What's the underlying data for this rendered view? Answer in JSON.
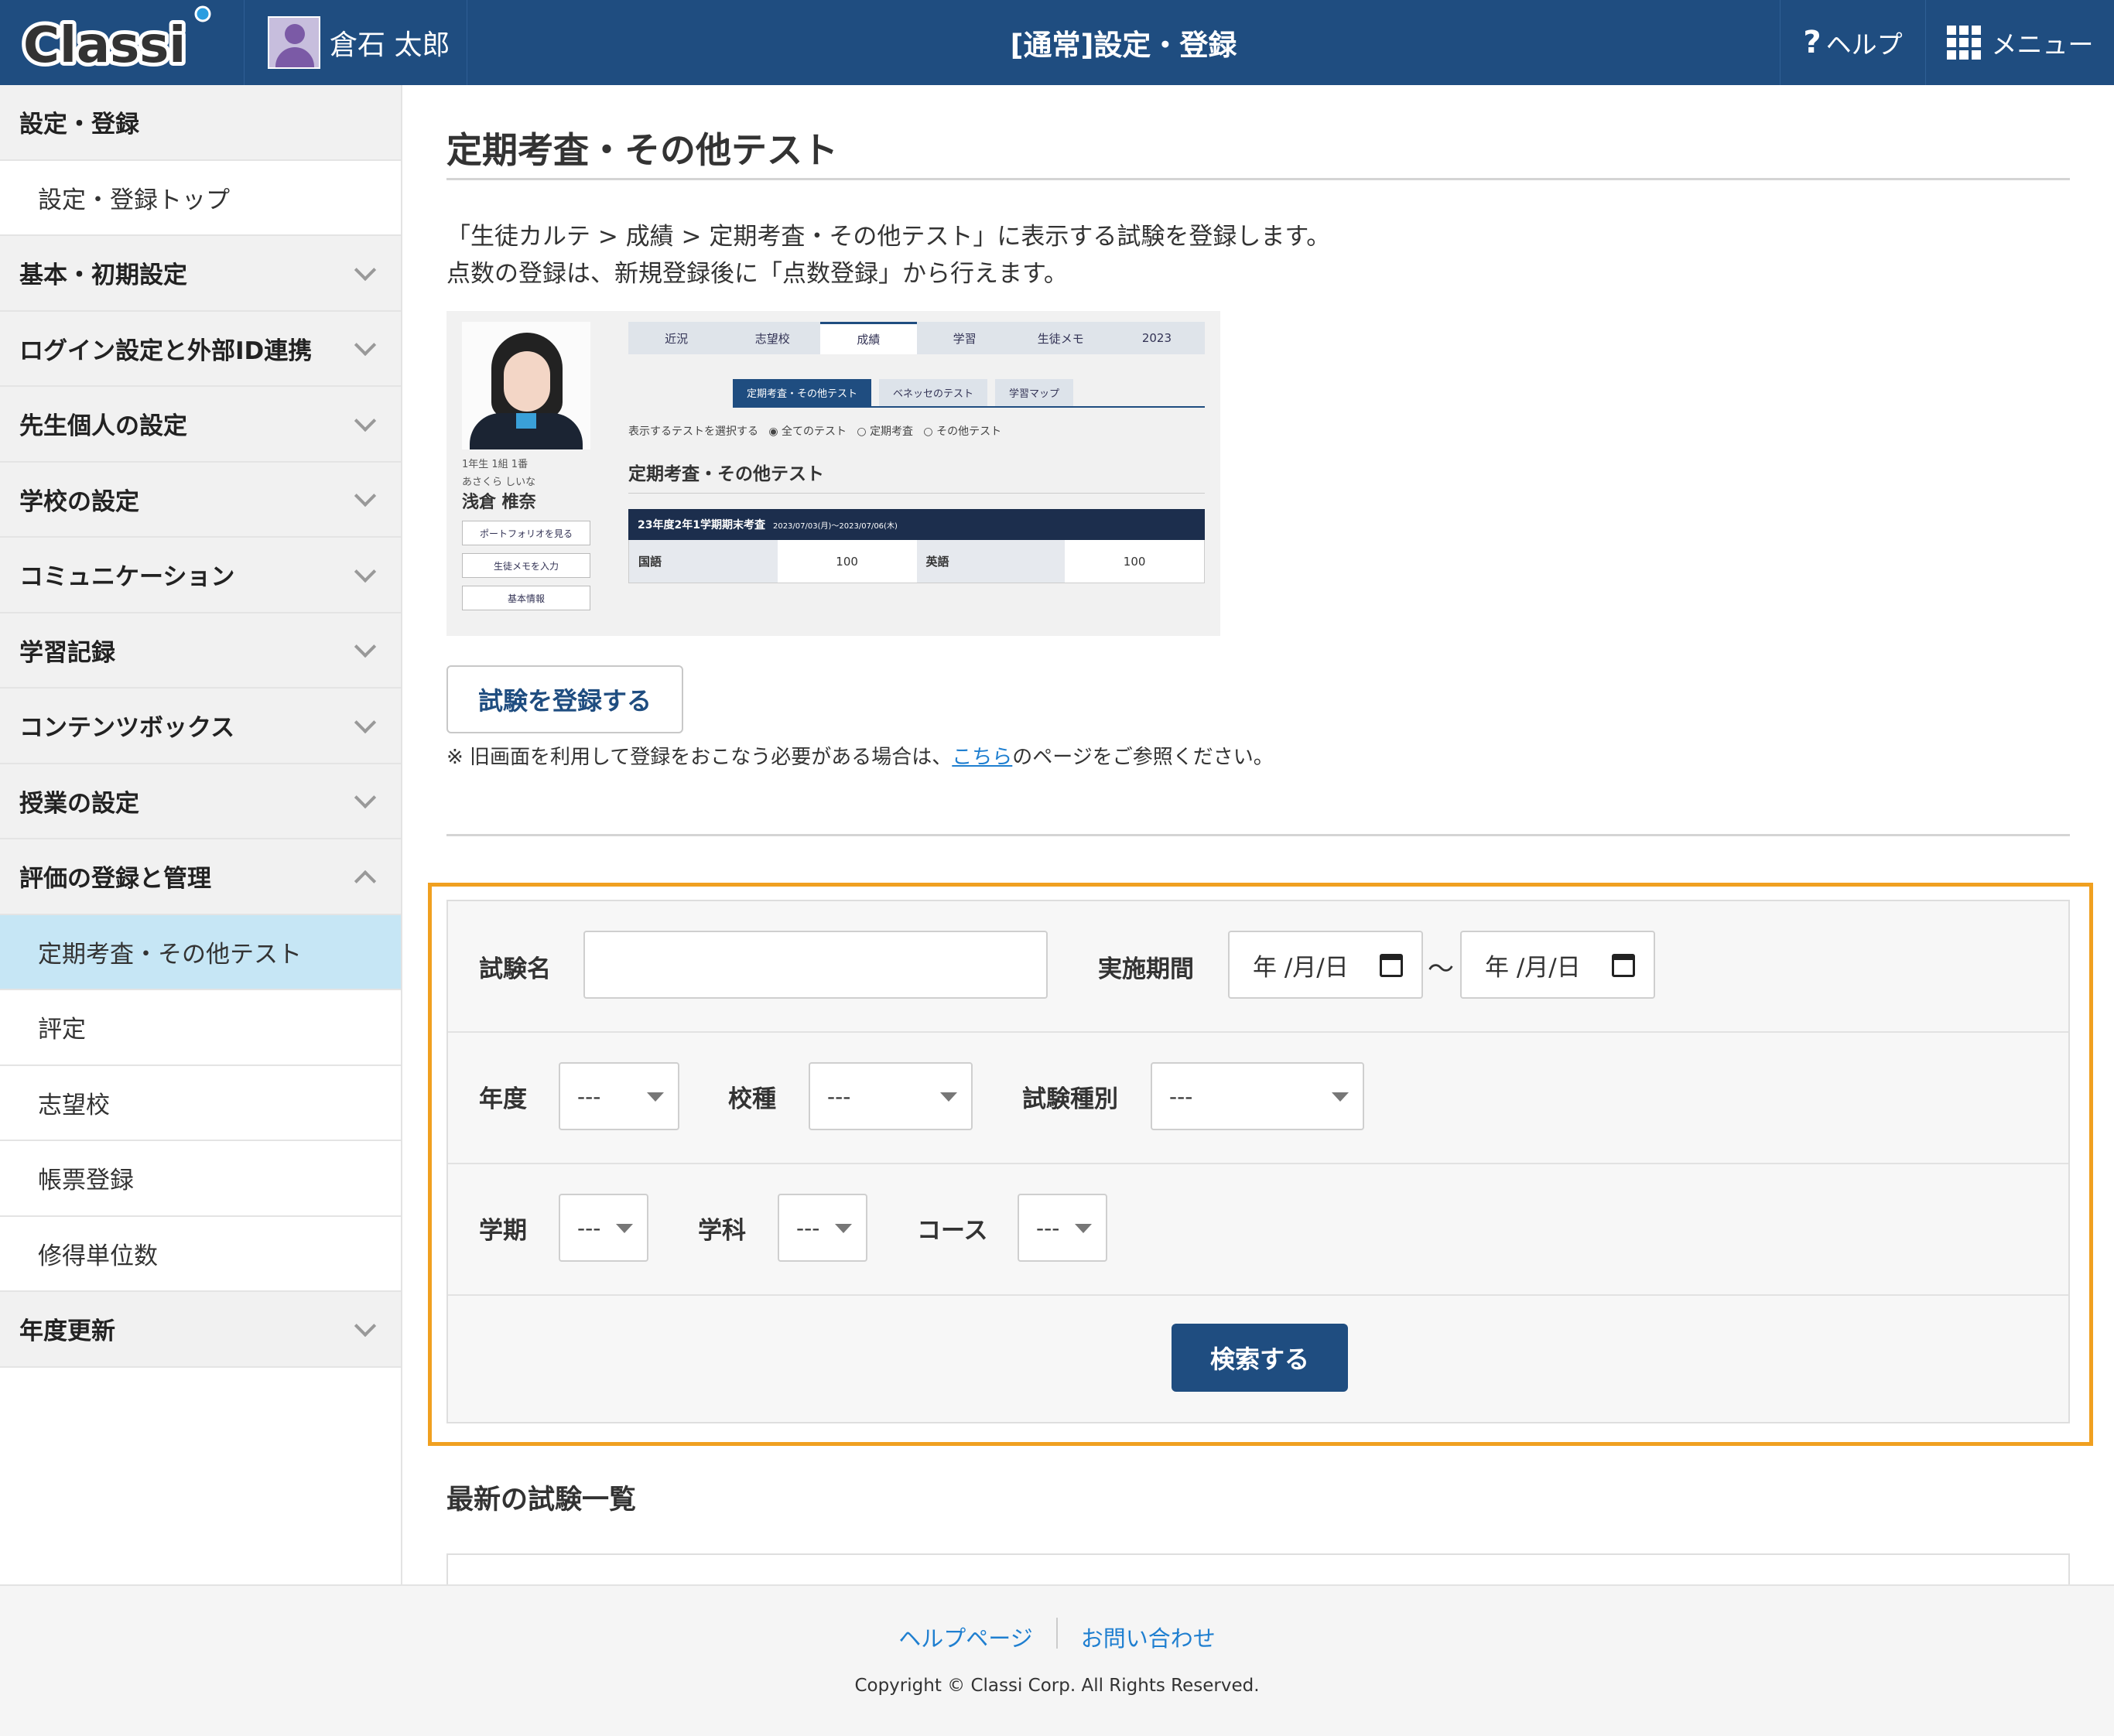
{
  "header": {
    "logo_text": "Classi",
    "user_name": "倉石 太郎",
    "title": "[通常]設定・登録",
    "help_label": "ヘルプ",
    "menu_label": "メニュー",
    "accent": "#1f4d80"
  },
  "sidebar": {
    "items": [
      {
        "label": "設定・登録",
        "type": "category"
      },
      {
        "label": "設定・登録トップ",
        "type": "sub"
      },
      {
        "label": "基本・初期設定",
        "type": "category"
      },
      {
        "label": "ログイン設定と外部ID連携",
        "type": "category"
      },
      {
        "label": "先生個人の設定",
        "type": "category"
      },
      {
        "label": "学校の設定",
        "type": "category"
      },
      {
        "label": "コミュニケーション",
        "type": "category"
      },
      {
        "label": "学習記録",
        "type": "category"
      },
      {
        "label": "コンテンツボックス",
        "type": "category"
      },
      {
        "label": "授業の設定",
        "type": "category"
      },
      {
        "label": "評価の登録と管理",
        "type": "category"
      },
      {
        "label": "定期考査・その他テスト",
        "type": "sub",
        "active": true
      },
      {
        "label": "評定",
        "type": "sub"
      },
      {
        "label": "志望校",
        "type": "sub"
      },
      {
        "label": "帳票登録",
        "type": "sub"
      },
      {
        "label": "修得単位数",
        "type": "sub"
      },
      {
        "label": "年度更新",
        "type": "category"
      }
    ]
  },
  "main": {
    "title": "定期考査・その他テスト",
    "desc_line1": "「生徒カルテ > 成績 > 定期考査・その他テスト」に表示する試験を登録します。",
    "desc_line2": "点数の登録は、新規登録後に「点数登録」から行えます。",
    "register_button": "試験を登録する",
    "note_prefix": "※ 旧画面を利用して登録をおこなう必要がある場合は、",
    "note_link": "こちら",
    "note_suffix": "のページをご参照ください。",
    "list_heading": "最新の試験一覧"
  },
  "preview": {
    "grade": "1年生 1組 1番",
    "kana": "あさくら しいな",
    "student_name": "浅倉 椎奈",
    "buttons": [
      "ポートフォリオを見る",
      "生徒メモを入力",
      "基本情報"
    ],
    "tabs": [
      "近況",
      "志望校",
      "成績",
      "学習",
      "生徒メモ",
      "2023"
    ],
    "subtabs": [
      "定期考査・その他テスト",
      "ベネッセのテスト",
      "学習マップ"
    ],
    "radio_label": "表示するテストを選択する",
    "radio_options": [
      "全てのテスト",
      "定期考査",
      "その他テスト"
    ],
    "heading": "定期考査・その他テスト",
    "exam_bar": "23年度2年1学期期末考査",
    "exam_dates": "2023/07/03(月)〜2023/07/06(木)",
    "row": [
      "国語",
      "100",
      "英語",
      "100"
    ]
  },
  "search": {
    "exam_name_label": "試験名",
    "exam_name_value": "",
    "period_label": "実施期間",
    "date_from": "年 /月/日",
    "date_to": "年 /月/日",
    "tilde": "〜",
    "year_label": "年度",
    "year_value": "---",
    "school_type_label": "校種",
    "school_type_value": "---",
    "exam_type_label": "試験種別",
    "exam_type_value": "---",
    "term_label": "学期",
    "term_value": "---",
    "dept_label": "学科",
    "dept_value": "---",
    "course_label": "コース",
    "course_value": "---",
    "search_button": "検索する",
    "highlight_color": "#f0a020"
  },
  "footer": {
    "help_link": "ヘルプページ",
    "contact_link": "お問い合わせ",
    "copyright": "Copyright © Classi Corp. All Rights Reserved."
  }
}
